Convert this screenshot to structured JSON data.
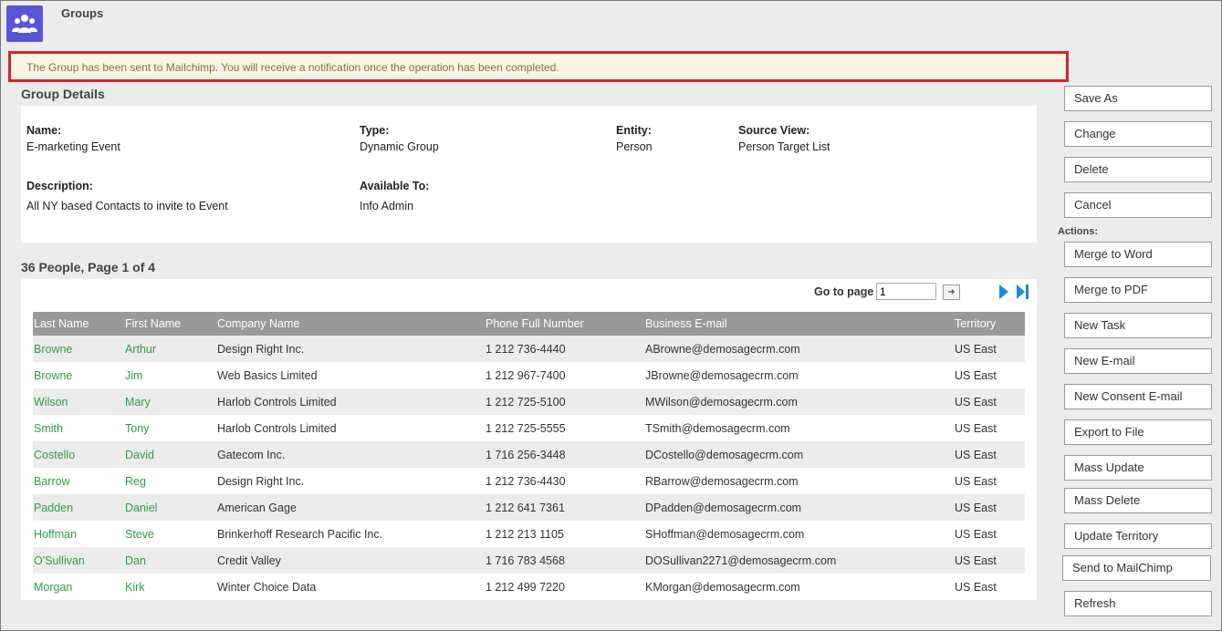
{
  "header": {
    "title": "Groups",
    "icon": "group-people-icon",
    "icon_color": "#5856d6"
  },
  "notice": {
    "text": "The Group has been sent to Mailchimp. You will receive a notification once the operation has been completed.",
    "border_color": "#d9232e"
  },
  "details": {
    "section_title": "Group Details",
    "name_label": "Name:",
    "name_value": "E-marketing Event",
    "type_label": "Type:",
    "type_value": "Dynamic Group",
    "entity_label": "Entity:",
    "entity_value": "Person",
    "source_label": "Source View:",
    "source_value": "Person Target List",
    "description_label": "Description:",
    "description_value": "All NY based Contacts to invite to Event",
    "available_label": "Available To:",
    "available_value": "Info Admin"
  },
  "list": {
    "section_title": "36 People, Page 1 of 4",
    "goto_label": "Go to page",
    "goto_value": "1",
    "columns": [
      "Last Name",
      "First Name",
      "Company Name",
      "Phone Full Number",
      "Business E-mail",
      "Territory"
    ],
    "rows": [
      [
        "Browne",
        "Arthur",
        "Design Right Inc.",
        "1 212 736-4440",
        "ABrowne@demosagecrm.com",
        "US East"
      ],
      [
        "Browne",
        "Jim",
        "Web Basics Limited",
        "1 212 967-7400",
        "JBrowne@demosagecrm.com",
        "US East"
      ],
      [
        "Wilson",
        "Mary",
        "Harlob Controls Limited",
        "1 212 725-5100",
        "MWilson@demosagecrm.com",
        "US East"
      ],
      [
        "Smith",
        "Tony",
        "Harlob Controls Limited",
        "1 212 725-5555",
        "TSmith@demosagecrm.com",
        "US East"
      ],
      [
        "Costello",
        "David",
        "Gatecom Inc.",
        "1 716 256-3448",
        "DCostello@demosagecrm.com",
        "US East"
      ],
      [
        "Barrow",
        "Reg",
        "Design Right Inc.",
        "1 212 736-4430",
        "RBarrow@demosagecrm.com",
        "US East"
      ],
      [
        "Padden",
        "Daniel",
        "American Gage",
        "1 212 641 7361",
        "DPadden@demosagecrm.com",
        "US East"
      ],
      [
        "Hoffman",
        "Steve",
        "Brinkerhoff Research Pacific Inc.",
        "1 212 213 1105",
        "SHoffman@demosagecrm.com",
        "US East"
      ],
      [
        "O'Sullivan",
        "Dan",
        "Credit Valley",
        "1 716 783 4568",
        "DOSullivan2271@demosagecrm.com",
        "US East"
      ],
      [
        "Morgan",
        "Kirk",
        "Winter Choice Data",
        "1 212 499 7220",
        "KMorgan@demosagecrm.com",
        "US East"
      ]
    ]
  },
  "buttons": {
    "save_as": "Save As",
    "change": "Change",
    "delete": "Delete",
    "cancel": "Cancel",
    "actions_label": "Actions:",
    "merge_word": "Merge to Word",
    "merge_pdf": "Merge to PDF",
    "new_task": "New Task",
    "new_email": "New E-mail",
    "new_consent_email": "New Consent E-mail",
    "export_file": "Export to File",
    "mass_update": "Mass Update",
    "mass_delete": "Mass Delete",
    "update_territory": "Update Territory",
    "send_mailchimp": "Send to MailChimp",
    "refresh": "Refresh"
  },
  "colors": {
    "link_green": "#2f9e44",
    "pager_blue": "#1e88d6",
    "header_gray": "#999999"
  }
}
